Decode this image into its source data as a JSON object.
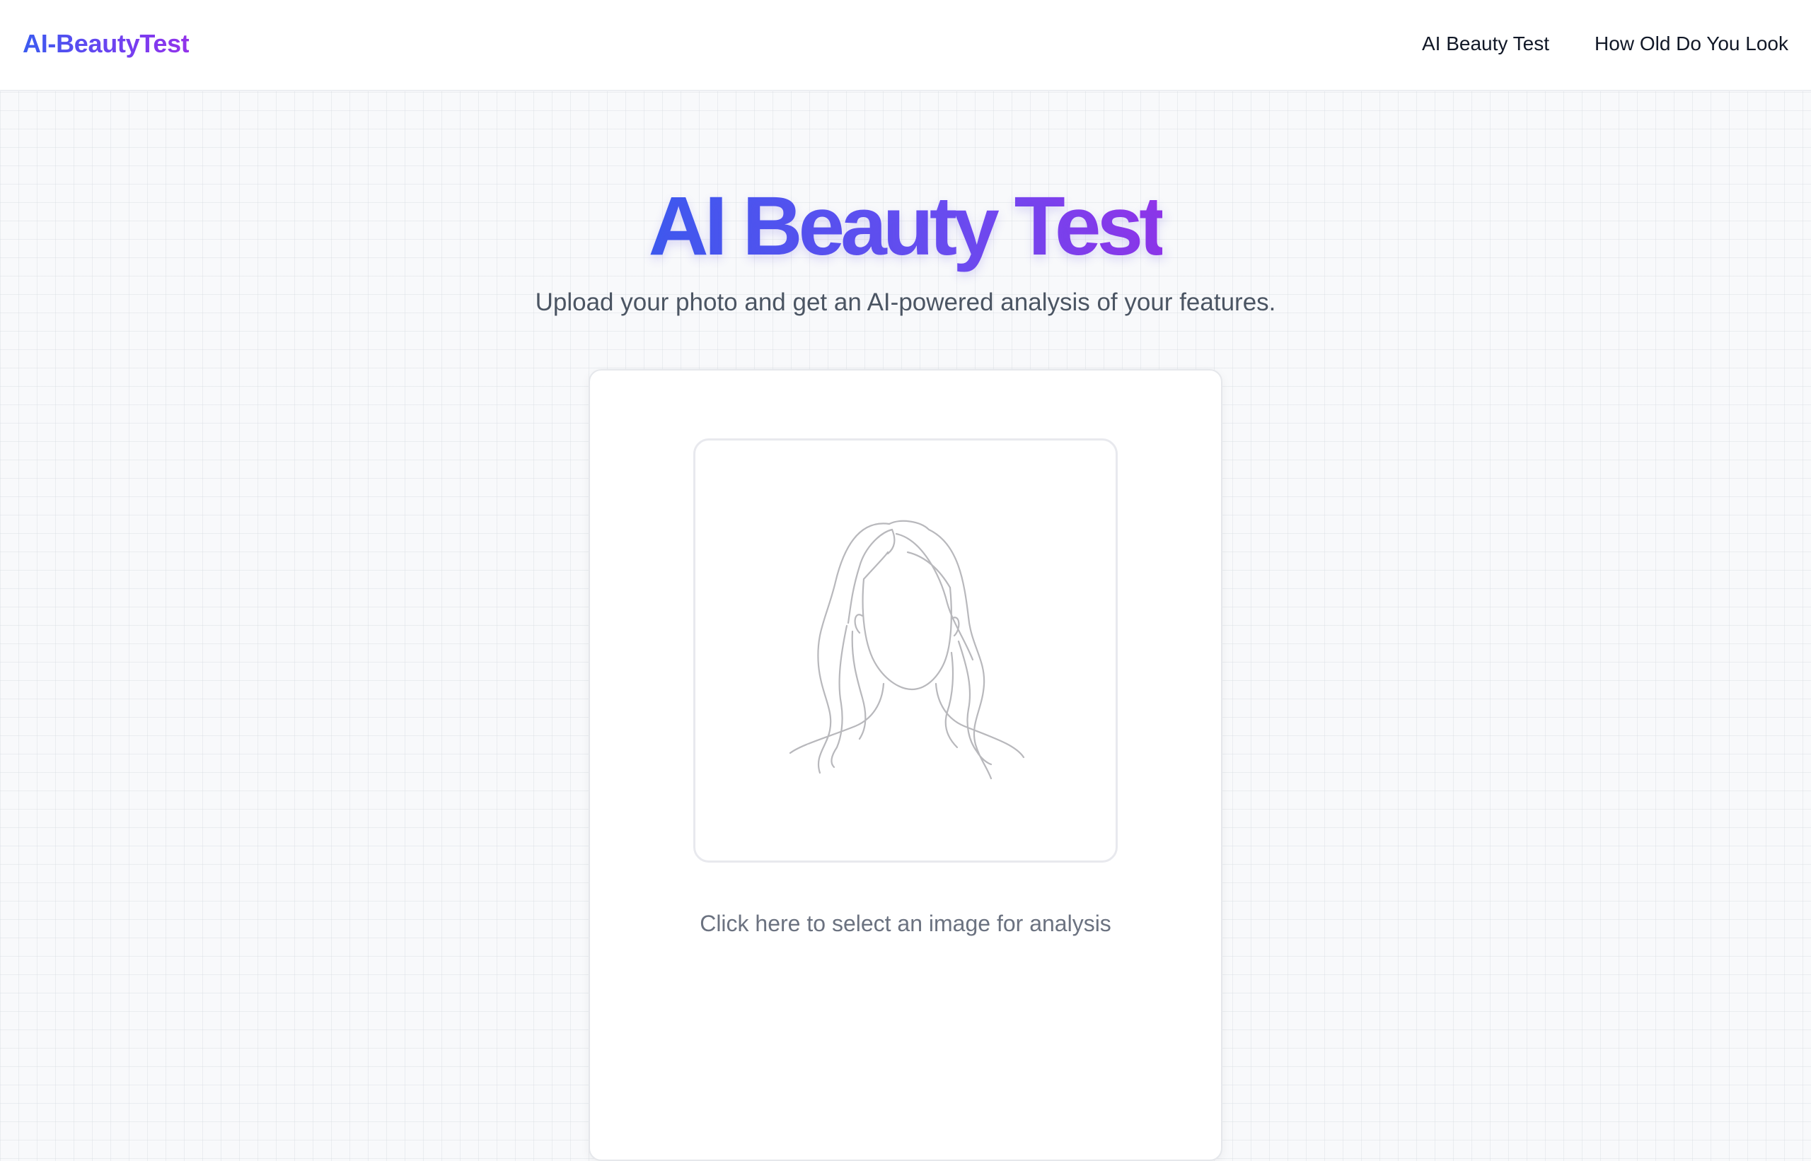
{
  "header": {
    "brand": "AI-BeautyTest",
    "nav": [
      {
        "label": "AI Beauty Test"
      },
      {
        "label": "How Old Do You Look"
      }
    ]
  },
  "hero": {
    "title": "AI Beauty Test",
    "subtitle": "Upload your photo and get an AI-powered analysis of your features."
  },
  "upload": {
    "placeholder_icon": "face-outline-icon",
    "hint": "Click here to select an image for analysis"
  },
  "colors": {
    "gradient_start": "#3b5bf0",
    "gradient_end": "#9333ea",
    "text_muted": "#6b7280"
  }
}
